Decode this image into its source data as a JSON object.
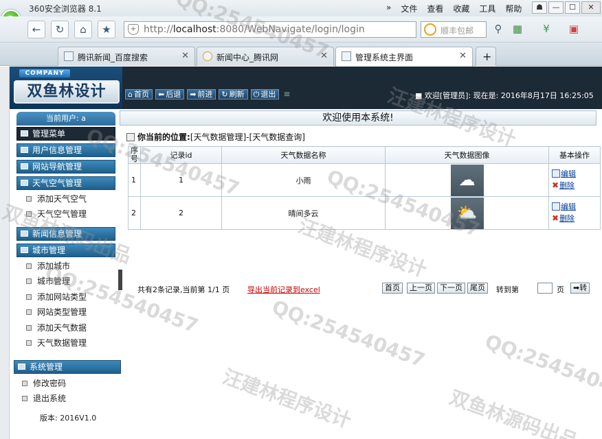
{
  "browser": {
    "title": "360安全浏览器 8.1",
    "menu": [
      "»",
      "文件",
      "查看",
      "收藏",
      "工具",
      "帮助"
    ],
    "address": {
      "prefix": "http://",
      "host": "localhost",
      "rest": ":8080/WebNavigate/login/login"
    },
    "search_placeholder": "顺丰包邮",
    "tabs": [
      {
        "label": "腾讯新闻_百度搜索",
        "active": false
      },
      {
        "label": "新闻中心_腾讯网",
        "active": false
      },
      {
        "label": "管理系统主界面",
        "active": true
      }
    ],
    "new_tab": "+"
  },
  "site": {
    "company_tag": "COMPANY",
    "logo": "双鱼林设计",
    "nav": [
      {
        "icon": "home-icon",
        "label": "首页"
      },
      {
        "icon": "back-icon",
        "label": "后退"
      },
      {
        "icon": "forward-icon",
        "label": "前进"
      },
      {
        "icon": "refresh-icon",
        "label": "刷新"
      },
      {
        "icon": "power-icon",
        "label": "退出"
      }
    ],
    "status": "■ 欢迎[管理员]: 现在是: 2016年8月17日 16:25:05"
  },
  "sidebar": {
    "current_user": "当前用户: a",
    "menu_title": "管理菜单",
    "sections": [
      {
        "label": "用户信息管理",
        "items": []
      },
      {
        "label": "网站导航管理",
        "items": []
      },
      {
        "label": "天气空气管理",
        "items": [
          "添加天气空气",
          "天气空气管理"
        ]
      },
      {
        "label": "新闻信息管理",
        "items": []
      },
      {
        "label": "城市管理",
        "items": [
          "添加城市",
          "城市管理",
          "添加网站类型",
          "网站类型管理",
          "添加天气数据",
          "天气数据管理"
        ]
      }
    ],
    "system": {
      "label": "系统管理",
      "items": [
        "修改密码",
        "退出系统"
      ]
    },
    "version": "版本: 2016V1.0"
  },
  "main": {
    "welcome": "欢迎使用本系统!",
    "location_label": "你当前的位置:",
    "location_path": "[天气数据管理]-[天气数据查询]",
    "table": {
      "headers": [
        "序号",
        "记录id",
        "天气数据名称",
        "天气数据图像",
        "基本操作"
      ],
      "rows": [
        {
          "index": "1",
          "id": "1",
          "name": "小雨",
          "image_icon": "cloud-rain-icon",
          "edit": "编辑",
          "delete": "删除"
        },
        {
          "index": "2",
          "id": "2",
          "name": "晴间多云",
          "image_icon": "sun-cloud-icon",
          "edit": "编辑",
          "delete": "删除"
        }
      ]
    },
    "pager": {
      "summary": "共有2条记录,当前第 1/1 页",
      "export": "导出当前记录到excel",
      "first": "首页",
      "prev": "上一页",
      "next": "下一页",
      "last": "尾页",
      "jump_to": "转到第",
      "page_unit": "页",
      "go": "➡转"
    }
  },
  "watermarks": [
    "QQ:254540457",
    "汪建林程序设计",
    "双鱼林源码出品"
  ]
}
